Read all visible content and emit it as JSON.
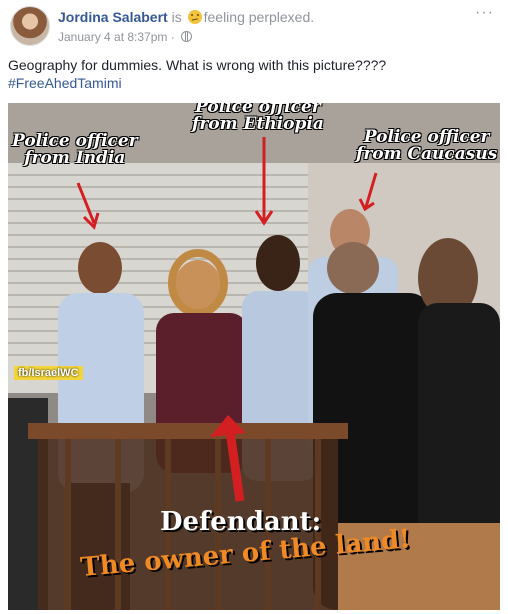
{
  "post": {
    "author": "Jordina Salabert",
    "is_text": "is",
    "feeling": "feeling perplexed.",
    "timestamp": "January 4 at 8:37pm",
    "separator": "·",
    "more_label": "···",
    "body_line1": "Geography for dummies. What is wrong with this picture????",
    "hashtag": "#FreeAhedTamimi",
    "icons": {
      "feeling": "perplexed-emoji-icon",
      "privacy": "globe-icon",
      "options": "more-options-icon"
    }
  },
  "photo": {
    "label_india_1": "Police officer",
    "label_india_2": "from India",
    "label_ethiopia_1": "Police officer",
    "label_ethiopia_2": "from Ethiopia",
    "label_caucasus_1": "Police officer",
    "label_caucasus_2": "from Caucasus",
    "watermark": "fb/IsraelWC",
    "defendant": "Defendant:",
    "owner": "The owner of the land!",
    "colors": {
      "arrow": "#d41f22",
      "owner_text": "#f08a24"
    }
  }
}
